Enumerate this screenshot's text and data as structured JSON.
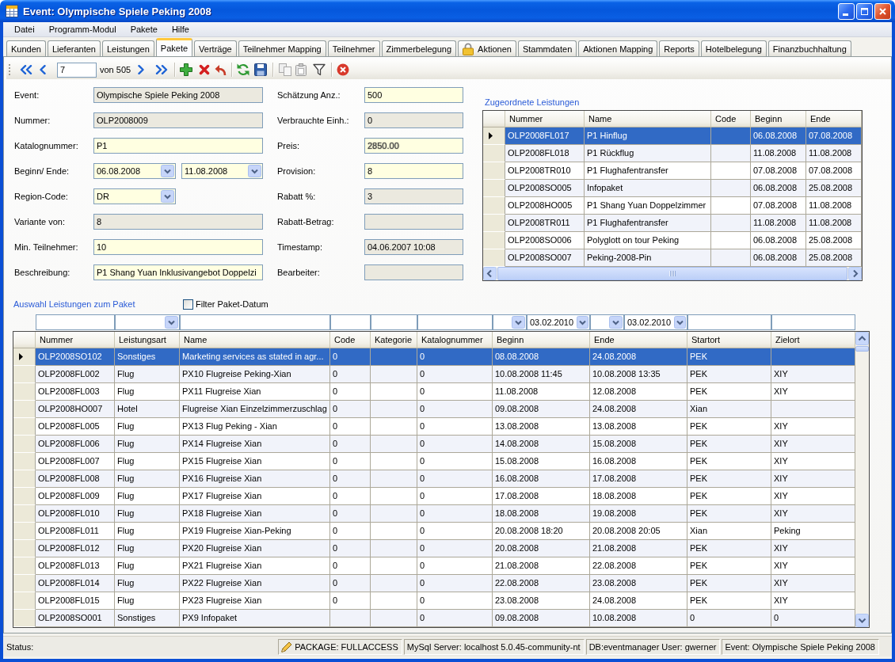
{
  "window": {
    "title": "Event: Olympische Spiele Peking 2008"
  },
  "menu": [
    "Datei",
    "Programm-Modul",
    "Pakete",
    "Hilfe"
  ],
  "tabs": [
    {
      "label": "Kunden",
      "selected": false,
      "locked": false
    },
    {
      "label": "Lieferanten",
      "selected": false,
      "locked": false
    },
    {
      "label": "Leistungen",
      "selected": false,
      "locked": false
    },
    {
      "label": "Pakete",
      "selected": true,
      "locked": false
    },
    {
      "label": "Verträge",
      "selected": false,
      "locked": false
    },
    {
      "label": "Teilnehmer Mapping",
      "selected": false,
      "locked": false
    },
    {
      "label": "Teilnehmer",
      "selected": false,
      "locked": false
    },
    {
      "label": "Zimmerbelegung",
      "selected": false,
      "locked": false
    },
    {
      "label": "Aktionen",
      "selected": false,
      "locked": true
    },
    {
      "label": "Stammdaten",
      "selected": false,
      "locked": false
    },
    {
      "label": "Aktionen Mapping",
      "selected": false,
      "locked": false
    },
    {
      "label": "Reports",
      "selected": false,
      "locked": false
    },
    {
      "label": "Hotelbelegung",
      "selected": false,
      "locked": false
    },
    {
      "label": "Finanzbuchhaltung",
      "selected": false,
      "locked": false
    }
  ],
  "toolbar": {
    "record": "7",
    "record_count": "von 505"
  },
  "form": {
    "left": [
      {
        "label": "Event:",
        "kind": "text",
        "value": "Olympische Spiele Peking 2008",
        "readonly": true
      },
      {
        "label": "Nummer:",
        "kind": "text",
        "value": "OLP2008009",
        "readonly": true
      },
      {
        "label": "Katalognummer:",
        "kind": "text",
        "value": "P1",
        "readonly": false
      },
      {
        "label": "Beginn/ Ende:",
        "kind": "date_range",
        "values": [
          "06.08.2008",
          "11.08.2008"
        ],
        "readonly": false
      },
      {
        "label": "Region-Code:",
        "kind": "combo",
        "value": "DR",
        "readonly": false
      },
      {
        "label": "Variante von:",
        "kind": "text",
        "value": "8",
        "readonly": true
      },
      {
        "label": "Min. Teilnehmer:",
        "kind": "text",
        "value": "10",
        "readonly": false
      },
      {
        "label": "Beschreibung:",
        "kind": "text",
        "value": "P1 Shang Yuan Inklusivangebot Doppelzi",
        "readonly": false
      }
    ],
    "right": [
      {
        "label": "Schätzung Anz.:",
        "kind": "text",
        "value": "500",
        "readonly": false
      },
      {
        "label": "Verbrauchte Einh.:",
        "kind": "text",
        "value": "0",
        "readonly": true
      },
      {
        "label": "Preis:",
        "kind": "text",
        "value": "2850.00",
        "readonly": false,
        "blurred": true
      },
      {
        "label": "Provision:",
        "kind": "text",
        "value": "8",
        "readonly": false
      },
      {
        "label": "Rabatt %:",
        "kind": "text",
        "value": "3",
        "readonly": true
      },
      {
        "label": "Rabatt-Betrag:",
        "kind": "text",
        "readonly": true
      },
      {
        "label": "Timestamp:",
        "kind": "text",
        "value": "04.06.2007 10:08",
        "readonly": true
      },
      {
        "label": "Bearbeiter:",
        "kind": "text",
        "readonly": true
      }
    ]
  },
  "assigned": {
    "title": "Zugeordnete Leistungen",
    "columns": [
      "Nummer",
      "Name",
      "Code",
      "Beginn",
      "Ende"
    ],
    "rows": [
      {
        "selected": true,
        "nummer": "OLP2008FL017",
        "name": "P1 Hinflug",
        "beginn": "06.08.2008",
        "ende": "07.08.2008"
      },
      {
        "selected": false,
        "nummer": "OLP2008FL018",
        "name": "P1 Rückflug",
        "beginn": "11.08.2008",
        "ende": "11.08.2008"
      },
      {
        "selected": false,
        "nummer": "OLP2008TR010",
        "name": "P1 Flughafentransfer",
        "beginn": "07.08.2008",
        "ende": "07.08.2008"
      },
      {
        "selected": false,
        "nummer": "OLP2008SO005",
        "name": "Infopaket",
        "beginn": "06.08.2008",
        "ende": "25.08.2008"
      },
      {
        "selected": false,
        "nummer": "OLP2008HO005",
        "name": "P1 Shang Yuan Doppelzimmer",
        "beginn": "07.08.2008",
        "ende": "11.08.2008"
      },
      {
        "selected": false,
        "nummer": "OLP2008TR011",
        "name": "P1 Flughafentransfer",
        "beginn": "11.08.2008",
        "ende": "11.08.2008"
      },
      {
        "selected": false,
        "nummer": "OLP2008SO006",
        "name": "Polyglott on tour Peking",
        "beginn": "06.08.2008",
        "ende": "25.08.2008"
      },
      {
        "selected": false,
        "nummer": "OLP2008SO007",
        "name": "Peking-2008-Pin",
        "beginn": "06.08.2008",
        "ende": "25.08.2008"
      }
    ]
  },
  "selection": {
    "title": "Auswahl Leistungen zum Paket",
    "filter_checkbox": {
      "label": "Filter Paket-Datum",
      "checked": false
    },
    "filters": [
      {
        "kind": "text"
      },
      {
        "kind": "combo"
      },
      {
        "kind": "text"
      },
      {
        "kind": "text"
      },
      {
        "kind": "text"
      },
      {
        "kind": "text"
      },
      {
        "kind": "date",
        "value": "03.02.2010"
      },
      {
        "kind": "date",
        "value": "03.02.2010"
      },
      {
        "kind": "text"
      },
      {
        "kind": "text"
      }
    ],
    "columns": [
      "Nummer",
      "Leistungsart",
      "Name",
      "Code",
      "Kategorie",
      "Katalognummer",
      "Beginn",
      "Ende",
      "Startort",
      "Zielort"
    ],
    "rows": [
      {
        "selected": true,
        "nummer": "OLP2008SO102",
        "leistungsart": "Sonstiges",
        "name": "Marketing services as stated in agr...",
        "code": "0",
        "katalognummer": "0",
        "beginn": "08.08.2008",
        "ende": "24.08.2008",
        "startort": "PEK"
      },
      {
        "selected": false,
        "nummer": "OLP2008FL002",
        "leistungsart": "Flug",
        "name": "PX10 Flugreise Peking-Xian",
        "code": "0",
        "katalognummer": "0",
        "beginn": "10.08.2008 11:45",
        "ende": "10.08.2008 13:35",
        "startort": "PEK",
        "zielort": "XIY"
      },
      {
        "selected": false,
        "nummer": "OLP2008FL003",
        "leistungsart": "Flug",
        "name": "PX11 Flugreise Xian",
        "code": "0",
        "katalognummer": "0",
        "beginn": "11.08.2008",
        "ende": "12.08.2008",
        "startort": "PEK",
        "zielort": "XIY"
      },
      {
        "selected": false,
        "nummer": "OLP2008HO007",
        "leistungsart": "Hotel",
        "name": "Flugreise Xian Einzelzimmerzuschlag",
        "code": "0",
        "katalognummer": "0",
        "beginn": "09.08.2008",
        "ende": "24.08.2008",
        "startort": "Xian"
      },
      {
        "selected": false,
        "nummer": "OLP2008FL005",
        "leistungsart": "Flug",
        "name": "PX13 Flug Peking - Xian",
        "code": "0",
        "katalognummer": "0",
        "beginn": "13.08.2008",
        "ende": "13.08.2008",
        "startort": "PEK",
        "zielort": "XIY"
      },
      {
        "selected": false,
        "nummer": "OLP2008FL006",
        "leistungsart": "Flug",
        "name": "PX14 Flugreise Xian",
        "code": "0",
        "katalognummer": "0",
        "beginn": "14.08.2008",
        "ende": "15.08.2008",
        "startort": "PEK",
        "zielort": "XIY"
      },
      {
        "selected": false,
        "nummer": "OLP2008FL007",
        "leistungsart": "Flug",
        "name": "PX15 Flugreise Xian",
        "code": "0",
        "katalognummer": "0",
        "beginn": "15.08.2008",
        "ende": "16.08.2008",
        "startort": "PEK",
        "zielort": "XIY"
      },
      {
        "selected": false,
        "nummer": "OLP2008FL008",
        "leistungsart": "Flug",
        "name": "PX16 Flugreise Xian",
        "code": "0",
        "katalognummer": "0",
        "beginn": "16.08.2008",
        "ende": "17.08.2008",
        "startort": "PEK",
        "zielort": "XIY"
      },
      {
        "selected": false,
        "nummer": "OLP2008FL009",
        "leistungsart": "Flug",
        "name": "PX17 Flugreise Xian",
        "code": "0",
        "katalognummer": "0",
        "beginn": "17.08.2008",
        "ende": "18.08.2008",
        "startort": "PEK",
        "zielort": "XIY"
      },
      {
        "selected": false,
        "nummer": "OLP2008FL010",
        "leistungsart": "Flug",
        "name": "PX18 Flugreise Xian",
        "code": "0",
        "katalognummer": "0",
        "beginn": "18.08.2008",
        "ende": "19.08.2008",
        "startort": "PEK",
        "zielort": "XIY"
      },
      {
        "selected": false,
        "nummer": "OLP2008FL011",
        "leistungsart": "Flug",
        "name": "PX19 Flugreise Xian-Peking",
        "code": "0",
        "katalognummer": "0",
        "beginn": "20.08.2008 18:20",
        "ende": "20.08.2008 20:05",
        "startort": "Xian",
        "zielort": "Peking"
      },
      {
        "selected": false,
        "nummer": "OLP2008FL012",
        "leistungsart": "Flug",
        "name": "PX20 Flugreise Xian",
        "code": "0",
        "katalognummer": "0",
        "beginn": "20.08.2008",
        "ende": "21.08.2008",
        "startort": "PEK",
        "zielort": "XIY"
      },
      {
        "selected": false,
        "nummer": "OLP2008FL013",
        "leistungsart": "Flug",
        "name": "PX21 Flugreise Xian",
        "code": "0",
        "katalognummer": "0",
        "beginn": "21.08.2008",
        "ende": "22.08.2008",
        "startort": "PEK",
        "zielort": "XIY"
      },
      {
        "selected": false,
        "nummer": "OLP2008FL014",
        "leistungsart": "Flug",
        "name": "PX22 Flugreise Xian",
        "code": "0",
        "katalognummer": "0",
        "beginn": "22.08.2008",
        "ende": "23.08.2008",
        "startort": "PEK",
        "zielort": "XIY"
      },
      {
        "selected": false,
        "nummer": "OLP2008FL015",
        "leistungsart": "Flug",
        "name": "PX23 Flugreise Xian",
        "code": "0",
        "katalognummer": "0",
        "beginn": "23.08.2008",
        "ende": "24.08.2008",
        "startort": "PEK",
        "zielort": "XIY"
      },
      {
        "selected": false,
        "nummer": "OLP2008SO001",
        "leistungsart": "Sonstiges",
        "name": "PX9 Infopaket",
        "katalognummer": "0",
        "beginn": "09.08.2008",
        "ende": "10.08.2008",
        "startort": "0",
        "zielort": "0"
      }
    ]
  },
  "status_bar": {
    "label": "Status:",
    "panels": [
      {
        "kind": "access",
        "text": "PACKAGE: FULLACCESS"
      },
      {
        "kind": "text",
        "text": "MySql Server: localhost 5.0.45-community-nt"
      },
      {
        "kind": "text",
        "text": "DB:eventmanager User: gwerner"
      },
      {
        "kind": "text",
        "text": "Event: Olympische Spiele Peking 2008"
      }
    ]
  }
}
